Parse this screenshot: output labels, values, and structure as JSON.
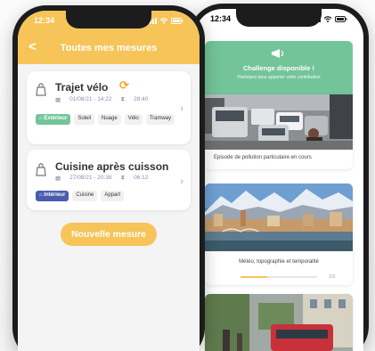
{
  "left": {
    "status_time": "12:34",
    "header_title": "Toutes mes mesures",
    "back_glyph": "<",
    "cards": [
      {
        "title": "Trajet vélo",
        "date": "01/08/21 - 14:22",
        "duration": "28:40",
        "chevron": "›",
        "icon": "bag-icon",
        "sync_icon": "sync-icon",
        "tags": [
          {
            "label": "Extérieur",
            "type": "green"
          },
          {
            "label": "Soleil",
            "type": "plain"
          },
          {
            "label": "Nuage",
            "type": "plain"
          },
          {
            "label": "Vélo",
            "type": "plain"
          },
          {
            "label": "Tramway",
            "type": "plain"
          }
        ]
      },
      {
        "title": "Cuisine après cuisson",
        "date": "27/08/21 - 20:38",
        "duration": "06:12",
        "chevron": "›",
        "icon": "bag-icon",
        "tags": [
          {
            "label": "Intérieur",
            "type": "navy"
          },
          {
            "label": "Cuisine",
            "type": "plain"
          },
          {
            "label": "Appart",
            "type": "plain"
          }
        ]
      }
    ],
    "new_button": "Nouvelle mesure"
  },
  "right": {
    "status_time": "12:34",
    "challenge_title": "Challenge disponible !",
    "challenge_subtitle": "Participez pour apporter votre contribution",
    "photos": [
      {
        "caption": "Episode de pollution particulaire en cours"
      },
      {
        "caption": "Météo, topographie et temporalité",
        "progress": 0.35,
        "counter": "1/3"
      }
    ]
  },
  "colors": {
    "yellow": "#f6c458",
    "green": "#74c49a",
    "navy": "#4b5bb0",
    "orange": "#f2a93b"
  }
}
